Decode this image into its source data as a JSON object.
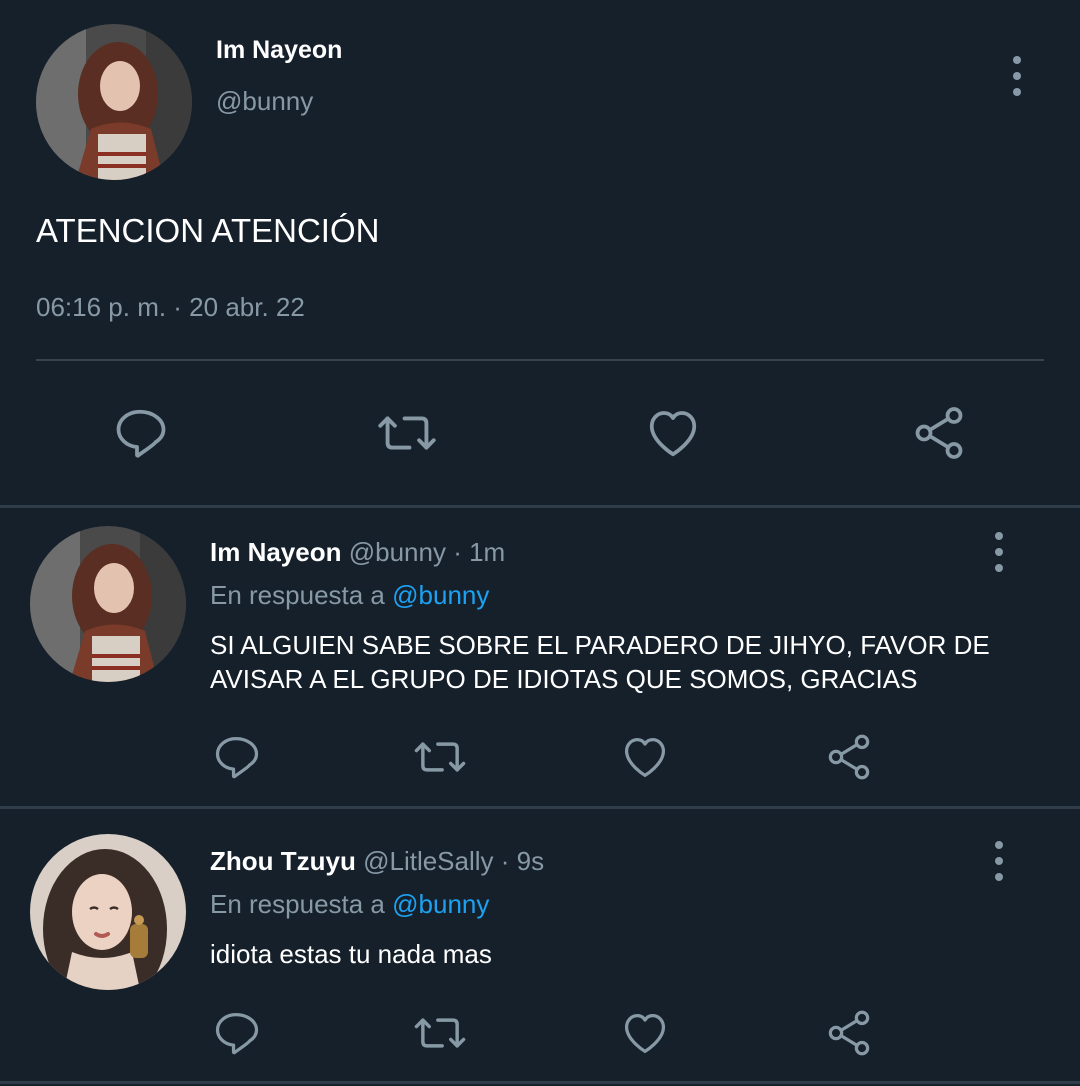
{
  "main_tweet": {
    "author_name": "Im Nayeon",
    "author_handle": "@bunny",
    "text": "ATENCION ATENCIÓN",
    "timestamp": "06:16 p. m. · 20 abr. 22",
    "avatar_icon": "profile-photo"
  },
  "replies": [
    {
      "author_name": "Im Nayeon",
      "handle_time": "@bunny · 1m",
      "reply_prefix": "En respuesta a",
      "reply_mention": "@bunny",
      "text": "SI ALGUIEN SABE SOBRE EL PARADERO DE JIHYO, FAVOR DE AVISAR A EL GRUPO DE IDIOTAS QUE SOMOS, GRACIAS"
    },
    {
      "author_name": "Zhou Tzuyu",
      "handle_time": "@LitleSally · 9s",
      "reply_prefix": "En respuesta a",
      "reply_mention": "@bunny",
      "text": "idiota estas tu nada mas"
    }
  ],
  "icons": {
    "reply": "reply-icon",
    "retweet": "retweet-icon",
    "like": "heart-icon",
    "share": "share-icon",
    "more": "more-vertical-icon"
  },
  "colors": {
    "background": "#15202b",
    "secondary_text": "#8899a6",
    "mention": "#1da1f2",
    "divider": "#38444d"
  }
}
